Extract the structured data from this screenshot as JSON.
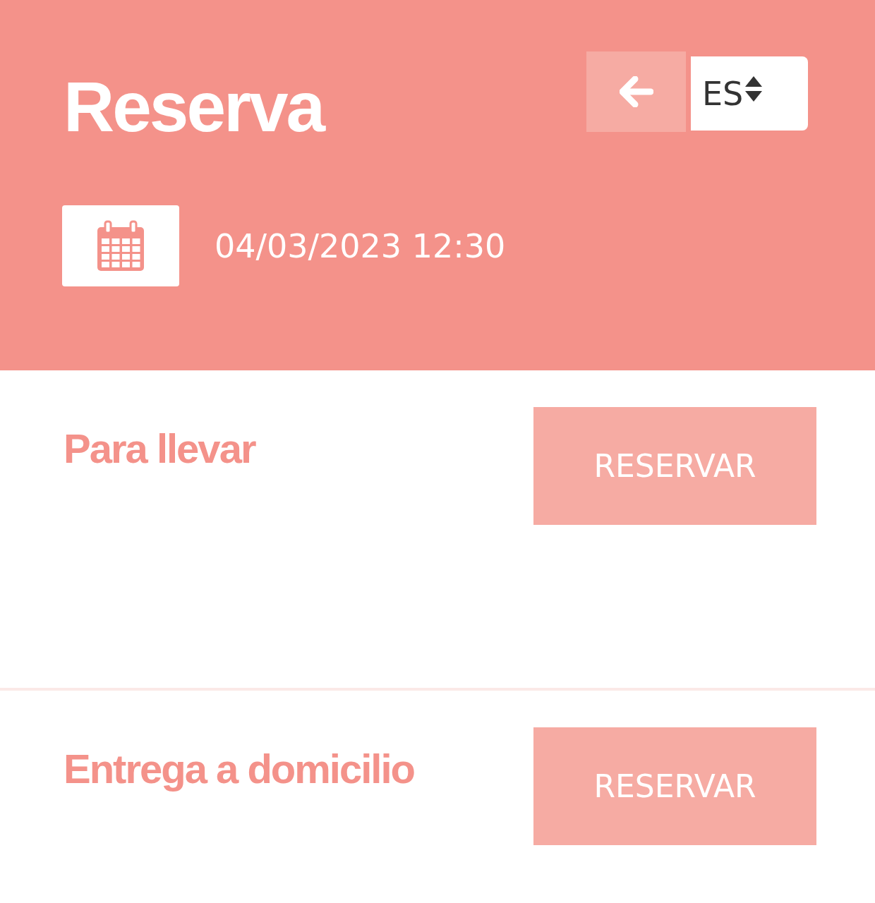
{
  "header": {
    "title": "Reserva",
    "language": "ES",
    "datetime": "04/03/2023 12:30"
  },
  "options": [
    {
      "label": "Para llevar",
      "button": "RESERVAR"
    },
    {
      "label": "Entrega a domicilio",
      "button": "RESERVAR"
    }
  ]
}
